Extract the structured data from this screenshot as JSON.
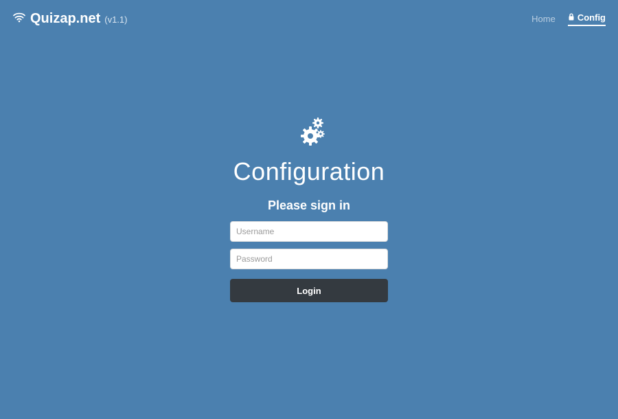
{
  "brand": {
    "name": "Quizap.net",
    "version": "(v1.1)"
  },
  "nav": {
    "home": "Home",
    "config": "Config"
  },
  "page": {
    "title": "Configuration",
    "signin_label": "Please sign in"
  },
  "form": {
    "username_placeholder": "Username",
    "password_placeholder": "Password",
    "username_value": "",
    "password_value": "",
    "login_label": "Login"
  },
  "colors": {
    "background": "#4b80af",
    "button_bg": "#343a40"
  }
}
